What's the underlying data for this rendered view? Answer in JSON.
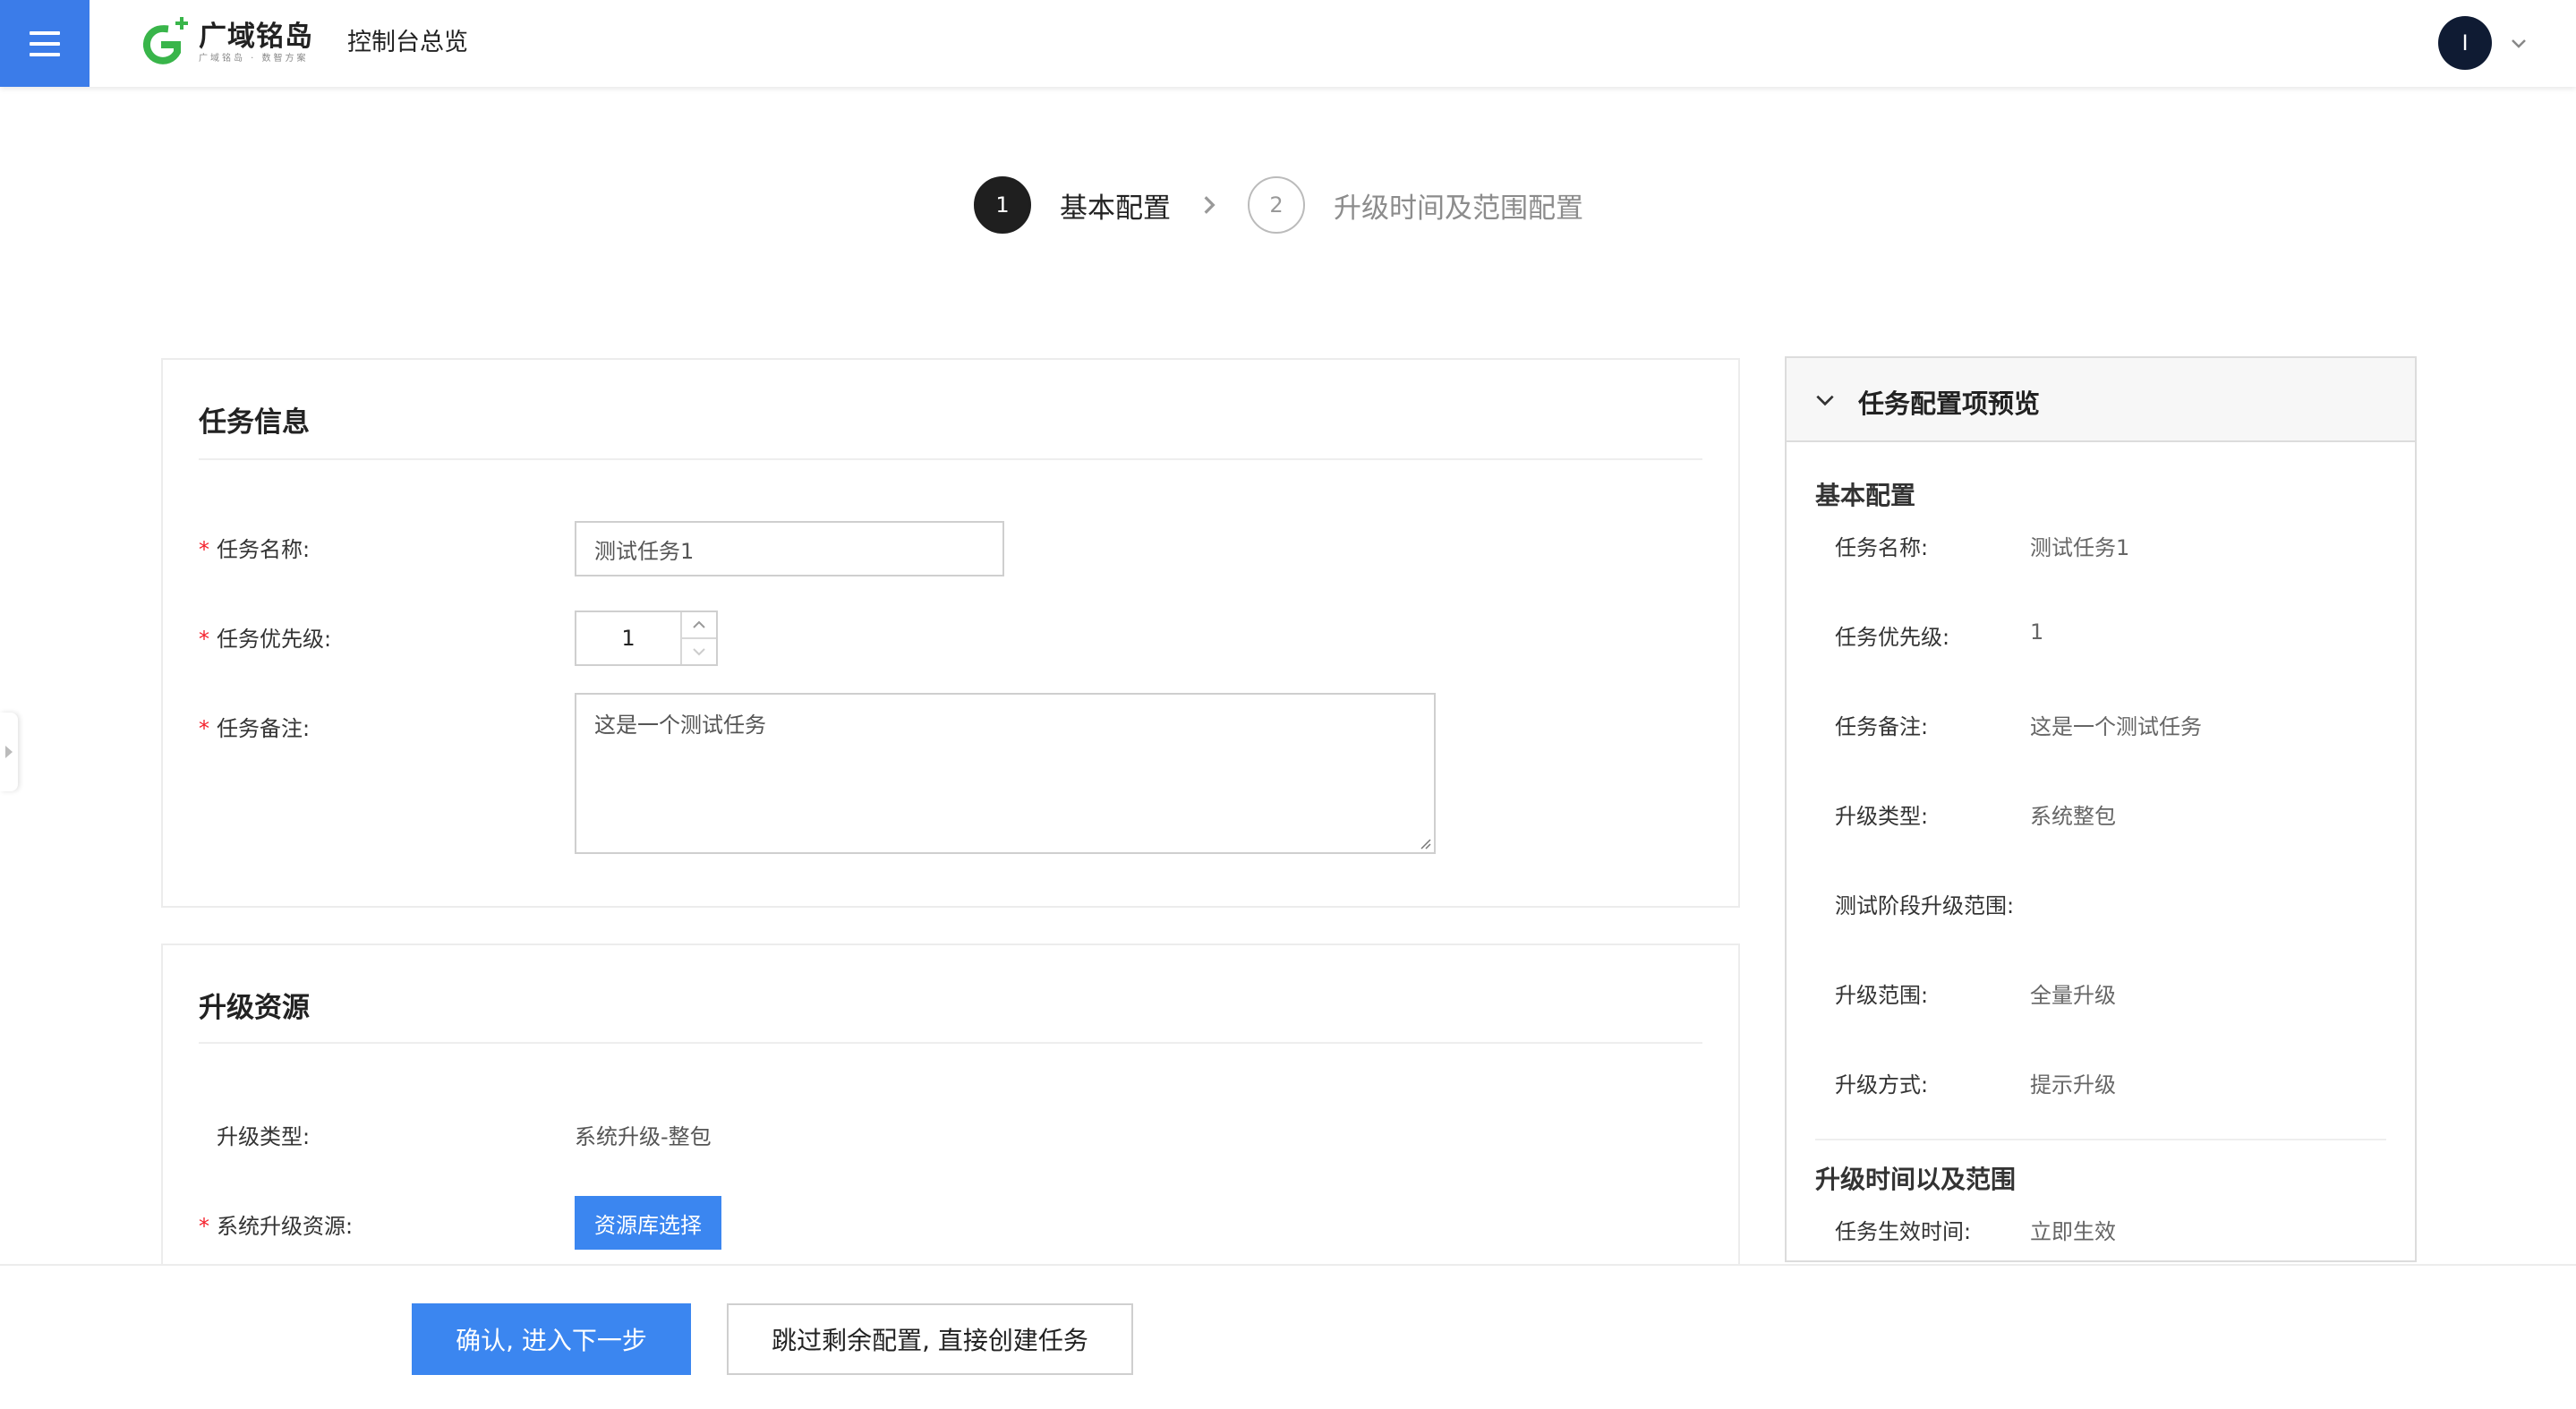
{
  "header": {
    "logo_name": "广域铭岛",
    "logo_sub": "广域铭岛 · 数智方案",
    "app_title": "控制台总览",
    "avatar_initial": "I",
    "brand_color": "#3b7ce9"
  },
  "steps": [
    {
      "number": "1",
      "label": "基本配置",
      "state": "active"
    },
    {
      "number": "2",
      "label": "升级时间及范围配置",
      "state": "inactive"
    }
  ],
  "task_info": {
    "title": "任务信息",
    "name_label": "任务名称:",
    "name_value": "测试任务1",
    "priority_label": "任务优先级:",
    "priority_value": "1",
    "note_label": "任务备注:",
    "note_value": "这是一个测试任务"
  },
  "upgrade_resource": {
    "title": "升级资源",
    "type_label": "升级类型:",
    "type_value": "系统升级-整包",
    "resource_label": "系统升级资源:",
    "resource_button": "资源库选择"
  },
  "preview": {
    "title": "任务配置项预览",
    "basic_section": "基本配置",
    "items": [
      {
        "label": "任务名称:",
        "value": "测试任务1"
      },
      {
        "label": "任务优先级:",
        "value": "1"
      },
      {
        "label": "任务备注:",
        "value": "这是一个测试任务"
      },
      {
        "label": "升级类型:",
        "value": "系统整包"
      },
      {
        "label": "测试阶段升级范围:",
        "value": ""
      },
      {
        "label": "升级范围:",
        "value": "全量升级"
      },
      {
        "label": "升级方式:",
        "value": "提示升级"
      }
    ],
    "time_section": "升级时间以及范围",
    "time_items": [
      {
        "label": "任务生效时间:",
        "value": "立即生效"
      }
    ]
  },
  "footer": {
    "confirm_button": "确认, 进入下一步",
    "skip_button": "跳过剩余配置, 直接创建任务"
  }
}
